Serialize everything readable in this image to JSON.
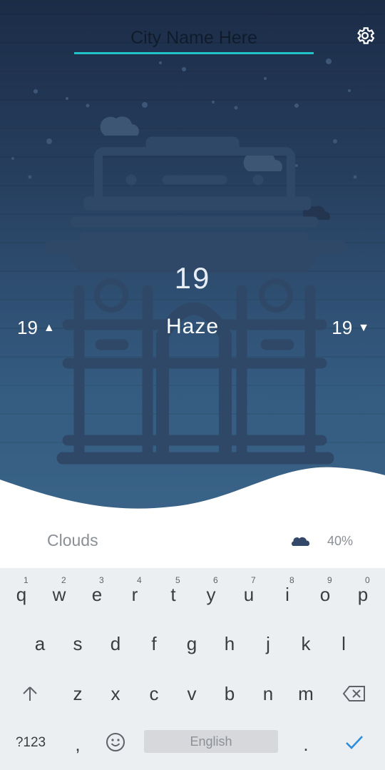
{
  "header": {
    "city_placeholder": "City Name Here",
    "settings_icon": "gear-icon"
  },
  "weather": {
    "temperature": "19",
    "high": "19",
    "low": "19",
    "condition": "Haze",
    "high_icon": "triangle-up",
    "low_icon": "triangle-down"
  },
  "details": [
    {
      "label": "Clouds",
      "icon": "cloud-icon",
      "value": "40%"
    }
  ],
  "keyboard": {
    "row1": [
      {
        "key": "q",
        "hint": "1"
      },
      {
        "key": "w",
        "hint": "2"
      },
      {
        "key": "e",
        "hint": "3"
      },
      {
        "key": "r",
        "hint": "4"
      },
      {
        "key": "t",
        "hint": "5"
      },
      {
        "key": "y",
        "hint": "6"
      },
      {
        "key": "u",
        "hint": "7"
      },
      {
        "key": "i",
        "hint": "8"
      },
      {
        "key": "o",
        "hint": "9"
      },
      {
        "key": "p",
        "hint": "0"
      }
    ],
    "row2": [
      "a",
      "s",
      "d",
      "f",
      "g",
      "h",
      "j",
      "k",
      "l"
    ],
    "row3": [
      "z",
      "x",
      "c",
      "v",
      "b",
      "n",
      "m"
    ],
    "symbols_label": "?123",
    "comma": ",",
    "period": ".",
    "space_label": "English"
  },
  "colors": {
    "accent": "#22c2c9",
    "sky_top": "#1b2c47",
    "sky_bottom": "#3a6388",
    "checkmark": "#2a8de0"
  }
}
